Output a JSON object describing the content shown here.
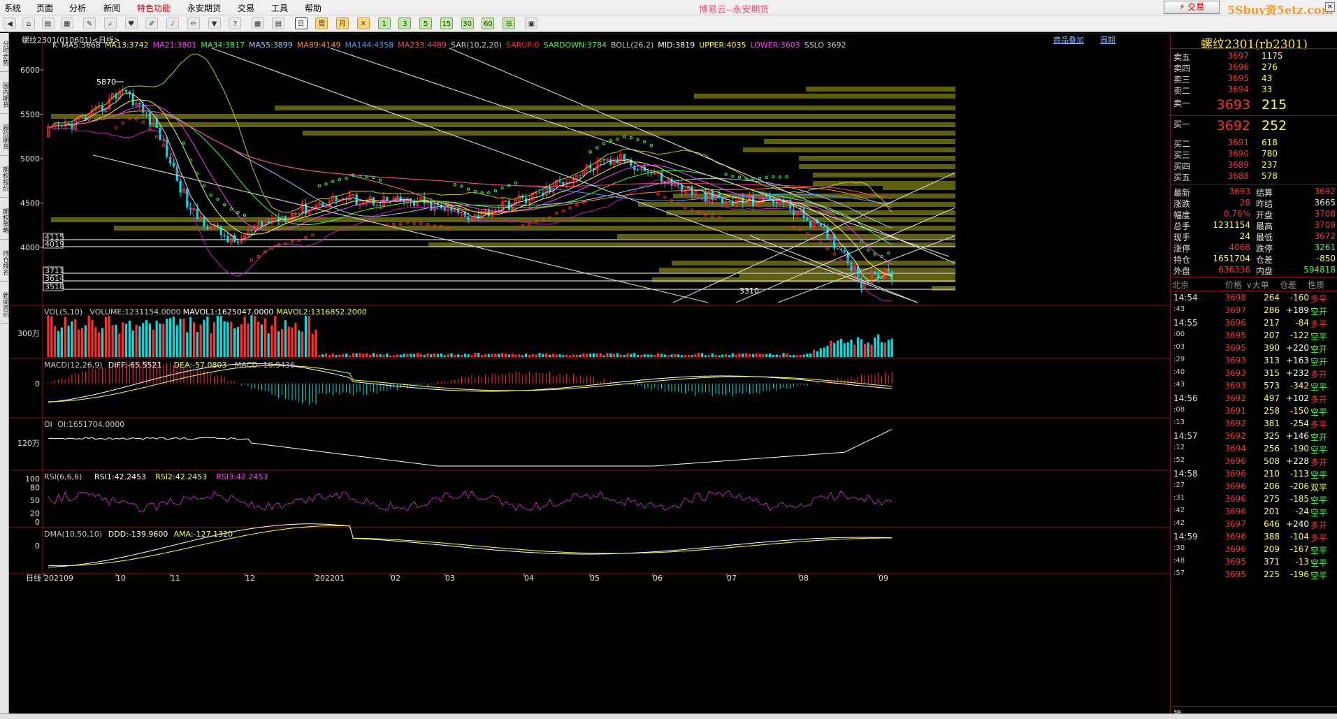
{
  "menu": [
    "系统",
    "页面",
    "分析",
    "新闻",
    "特色功能",
    "永安期货",
    "交易",
    "工具",
    "帮助"
  ],
  "app_title": "博易云--永安期货",
  "trade_button": "⚡ 交易",
  "brand": "5Sbuy资5etz.com",
  "left_tabs": [
    "分时走势",
    "国内期货",
    "报价期货",
    "期权报价",
    "期权策略",
    "持仓排名",
    "新闻资讯"
  ],
  "chart_header": {
    "symbol": "螺纹2301(010601)<日线>",
    "links": [
      "商品叠加",
      "周期"
    ],
    "ma_line": [
      {
        "t": "K",
        "c": "#c8c8c8"
      },
      {
        "t": "MA5:3668",
        "c": "#e0e0e0"
      },
      {
        "t": "MA13:3742",
        "c": "#ffff40"
      },
      {
        "t": "MA21:3801",
        "c": "#ff40ff"
      },
      {
        "t": "MA34:3817",
        "c": "#40ff40"
      },
      {
        "t": "MA55:3899",
        "c": "#a0c8ff"
      },
      {
        "t": "MA89:4149",
        "c": "#ff9020"
      },
      {
        "t": "MA144:4358",
        "c": "#40a0ff"
      },
      {
        "t": "MA233:4489",
        "c": "#ff4080"
      },
      {
        "t": "SAR(10,2,20)",
        "c": "#c8c8c8"
      },
      {
        "t": "SARUP:0",
        "c": "#ff3030"
      },
      {
        "t": "SARDOWN:3784",
        "c": "#40ff40"
      },
      {
        "t": "BOLL(26,2)",
        "c": "#c8c8c8"
      },
      {
        "t": "MID:3819",
        "c": "#ffffff"
      },
      {
        "t": "UPPER:4035",
        "c": "#ffff40"
      },
      {
        "t": "LOWER:3603",
        "c": "#ff40ff"
      },
      {
        "t": "SSLO 3692",
        "c": "#c8c8c8"
      }
    ]
  },
  "price_axis": [
    "6000",
    "5500",
    "5000",
    "4500",
    "4000"
  ],
  "level_labels": [
    "4115",
    "4019",
    "3711",
    "3614",
    "3518"
  ],
  "marks": {
    "high": "5870",
    "low": "3310"
  },
  "vol_panel": {
    "title": "VOL(5,10)",
    "values": [
      {
        "t": "VOLUME:1231154.0000",
        "c": "#c8c8c8"
      },
      {
        "t": "MAVOL1:1625047.0000",
        "c": "#ffffff"
      },
      {
        "t": "MAVOL2:1316852.2000",
        "c": "#ffff40"
      }
    ],
    "axis": "300万"
  },
  "macd_panel": {
    "title": "MACD(12,26,9)",
    "values": [
      {
        "t": "DIFF:-65.5521",
        "c": "#ffffff"
      },
      {
        "t": "DEA:-57.0803",
        "c": "#ffff40"
      },
      {
        "t": "MACD:-16.9436",
        "c": "#c8c8c8"
      }
    ],
    "axis": "0"
  },
  "oi_panel": {
    "title": "OI",
    "values": [
      {
        "t": "OI:1651704.0000",
        "c": "#c8c8c8"
      }
    ],
    "axis": "120万"
  },
  "rsi_panel": {
    "title": "RSI(6,6,6)",
    "values": [
      {
        "t": "RSI1:42.2453",
        "c": "#ffffff"
      },
      {
        "t": "RSI2:42.2453",
        "c": "#ffff40"
      },
      {
        "t": "RSI3:42.2453",
        "c": "#ff40ff"
      }
    ],
    "axis": [
      "100",
      "80",
      "50",
      "20",
      "0"
    ]
  },
  "dma_panel": {
    "title": "DMA(10,50,10)",
    "values": [
      {
        "t": "DDD:-139.9600",
        "c": "#ffffff"
      },
      {
        "t": "AMA:-127.1320",
        "c": "#ffff40"
      }
    ],
    "axis": "0"
  },
  "x_axis": {
    "period": "日线",
    "labels": [
      "202109",
      "10",
      "11",
      "12",
      "202201",
      "02",
      "03",
      "04",
      "05",
      "06",
      "07",
      "08",
      "09"
    ]
  },
  "quote": {
    "title": "螺纹2301(rb2301)",
    "asks": [
      {
        "label": "卖五",
        "price": "3697",
        "vol": "1175"
      },
      {
        "label": "卖四",
        "price": "3696",
        "vol": "276"
      },
      {
        "label": "卖三",
        "price": "3695",
        "vol": "43"
      },
      {
        "label": "卖二",
        "price": "3694",
        "vol": "33"
      },
      {
        "label": "卖一",
        "price": "3693",
        "vol": "215"
      }
    ],
    "bids": [
      {
        "label": "买一",
        "price": "3692",
        "vol": "252"
      },
      {
        "label": "买二",
        "price": "3691",
        "vol": "618"
      },
      {
        "label": "买三",
        "price": "3690",
        "vol": "780"
      },
      {
        "label": "买四",
        "price": "3689",
        "vol": "237"
      },
      {
        "label": "买五",
        "price": "3688",
        "vol": "578"
      }
    ],
    "stats": [
      {
        "l1": "最新",
        "v1": "3693",
        "c1": "#ff3030",
        "l2": "结算",
        "v2": "3692",
        "c2": "#ff3030"
      },
      {
        "l1": "涨跌",
        "v1": "28",
        "c1": "#ff3030",
        "l2": "昨结",
        "v2": "3665",
        "c2": "#e0e0e0"
      },
      {
        "l1": "幅度",
        "v1": "0.76%",
        "c1": "#ff3030",
        "l2": "开盘",
        "v2": "3708",
        "c2": "#ff3030"
      },
      {
        "l1": "总手",
        "v1": "1231154",
        "c1": "#ffff40",
        "l2": "最高",
        "v2": "3709",
        "c2": "#ff3030"
      },
      {
        "l1": "现手",
        "v1": "24",
        "c1": "#ffff40",
        "l2": "最低",
        "v2": "3672",
        "c2": "#ff3030"
      },
      {
        "l1": "涨停",
        "v1": "4068",
        "c1": "#ff3030",
        "l2": "跌停",
        "v2": "3261",
        "c2": "#40ff40"
      },
      {
        "l1": "持仓",
        "v1": "1651704",
        "c1": "#ffff40",
        "l2": "仓差",
        "v2": "-850",
        "c2": "#ffff40"
      },
      {
        "l1": "外盘",
        "v1": "636336",
        "c1": "#ff3030",
        "l2": "内盘",
        "v2": "594818",
        "c2": "#40ff40"
      }
    ],
    "tick_header": [
      "北京",
      "价格",
      "∨大单",
      "仓差",
      "性质"
    ],
    "ticks": [
      {
        "t": "14:54",
        "p": "3698",
        "v": "264",
        "d": "-160",
        "n": "多平",
        "big": true
      },
      {
        "t": ":43",
        "p": "3697",
        "v": "286",
        "d": "+189",
        "n": "空开",
        "big": false
      },
      {
        "t": "14:55",
        "p": "3696",
        "v": "217",
        "d": "-84",
        "n": "多平",
        "big": true
      },
      {
        "t": ":00",
        "p": "3695",
        "v": "207",
        "d": "-122",
        "n": "空平",
        "big": false
      },
      {
        "t": ":03",
        "p": "3695",
        "v": "390",
        "d": "+220",
        "n": "空开",
        "big": false
      },
      {
        "t": ":29",
        "p": "3693",
        "v": "313",
        "d": "+163",
        "n": "空开",
        "big": false
      },
      {
        "t": ":40",
        "p": "3693",
        "v": "315",
        "d": "+232",
        "n": "多开",
        "big": false
      },
      {
        "t": ":43",
        "p": "3693",
        "v": "573",
        "d": "-342",
        "n": "空平",
        "big": false
      },
      {
        "t": "14:56",
        "p": "3692",
        "v": "497",
        "d": "+102",
        "n": "多开",
        "big": true
      },
      {
        "t": ":08",
        "p": "3691",
        "v": "258",
        "d": "-150",
        "n": "空平",
        "big": false
      },
      {
        "t": ":13",
        "p": "3692",
        "v": "381",
        "d": "-254",
        "n": "多平",
        "big": false
      },
      {
        "t": "14:57",
        "p": "3692",
        "v": "325",
        "d": "+146",
        "n": "空开",
        "big": true
      },
      {
        "t": ":12",
        "p": "3694",
        "v": "256",
        "d": "-190",
        "n": "空平",
        "big": false
      },
      {
        "t": ":52",
        "p": "3696",
        "v": "508",
        "d": "+228",
        "n": "多开",
        "big": false
      },
      {
        "t": "14:58",
        "p": "3696",
        "v": "210",
        "d": "-113",
        "n": "空平",
        "big": true
      },
      {
        "t": ":27",
        "p": "3696",
        "v": "206",
        "d": "-206",
        "n": "双平",
        "big": false
      },
      {
        "t": ":31",
        "p": "3696",
        "v": "275",
        "d": "-185",
        "n": "空平",
        "big": false
      },
      {
        "t": ":42",
        "p": "3696",
        "v": "201",
        "d": "-24",
        "n": "空平",
        "big": false
      },
      {
        "t": ":42",
        "p": "3697",
        "v": "646",
        "d": "+240",
        "n": "多开",
        "big": false
      },
      {
        "t": "14:59",
        "p": "3696",
        "v": "388",
        "d": "-104",
        "n": "多平",
        "big": true
      },
      {
        "t": ":30",
        "p": "3696",
        "v": "209",
        "d": "-167",
        "n": "空平",
        "big": false
      },
      {
        "t": ":48",
        "p": "3695",
        "v": "371",
        "d": "-13",
        "n": "空平",
        "big": false
      },
      {
        "t": ":57",
        "p": "3695",
        "v": "225",
        "d": "-196",
        "n": "空平",
        "big": false
      }
    ],
    "footer": "笔"
  },
  "colors": {
    "up": "#ff3030",
    "down": "#00e0e0",
    "green": "#40ff40",
    "yellow": "#ffff40",
    "olive": "#6b6b10"
  }
}
